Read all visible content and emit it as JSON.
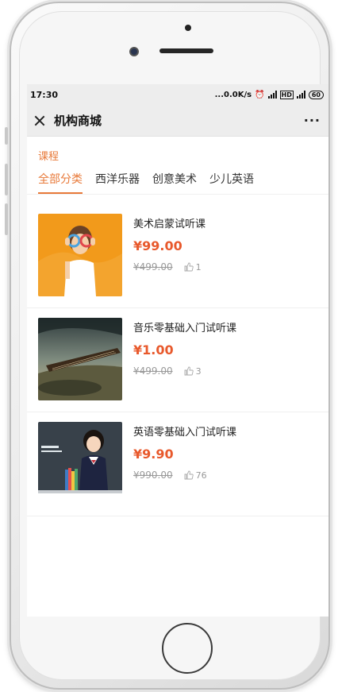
{
  "status_bar": {
    "time": "17:30",
    "speed": "...0.0K/s",
    "battery": "60"
  },
  "nav": {
    "title": "机构商城",
    "more": "···"
  },
  "section_label": "课程",
  "tabs": [
    {
      "label": "全部分类",
      "active": true
    },
    {
      "label": "西洋乐器",
      "active": false
    },
    {
      "label": "创意美术",
      "active": false
    },
    {
      "label": "少儿英语",
      "active": false
    }
  ],
  "courses": [
    {
      "name": "美术启蒙试听课",
      "price": "¥99.00",
      "original_price": "¥499.00",
      "likes": "1",
      "thumbnail": "girl-with-paint-glasses"
    },
    {
      "name": "音乐零基础入门试听课",
      "price": "¥1.00",
      "original_price": "¥499.00",
      "likes": "3",
      "thumbnail": "guitar-bridge-landscape"
    },
    {
      "name": "英语零基础入门试听课",
      "price": "¥9.90",
      "original_price": "¥990.00",
      "likes": "76",
      "thumbnail": "girl-with-books"
    }
  ],
  "colors": {
    "accent": "#e87a3a",
    "price": "#e8592c",
    "muted": "#999999"
  }
}
